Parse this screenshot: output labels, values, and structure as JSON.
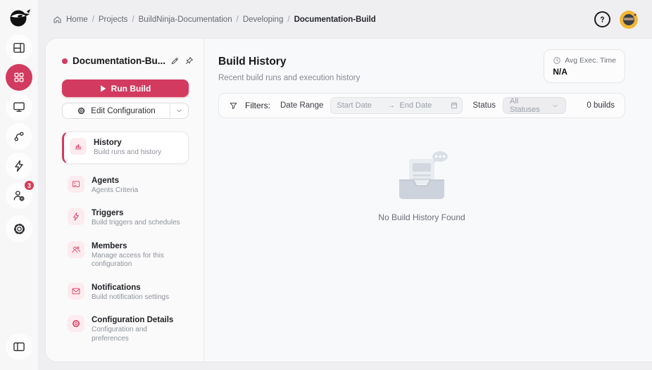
{
  "colors": {
    "accent": "#d23b5f",
    "accent_soft": "#fcebef",
    "badge": "#d53a52",
    "avatar_bg": "#f2b636"
  },
  "rail": {
    "icons": [
      "ninja-logo",
      "layout-icon",
      "apps-grid-icon",
      "monitor-icon",
      "git-branch-icon",
      "bolt-icon",
      "user-gear-icon",
      "gear-icon",
      "panel-toggle-icon"
    ],
    "active_icon": "apps-grid-icon",
    "badge_count": "3"
  },
  "header": {
    "breadcrumb": [
      "Home",
      "Projects",
      "BuildNinja-Documentation",
      "Developing",
      "Documentation-Build"
    ],
    "separator": "/"
  },
  "panel": {
    "title": "Documentation-Bu...",
    "run_build_label": "Run Build",
    "edit_config_label": "Edit Configuration",
    "menu": [
      {
        "label": "History",
        "desc": "Build runs and history",
        "icon": "chart-icon",
        "active": true
      },
      {
        "label": "Agents",
        "desc": "Agents Criteria",
        "icon": "agent-screen-icon",
        "active": false
      },
      {
        "label": "Triggers",
        "desc": "Build triggers and schedules",
        "icon": "bolt-icon",
        "active": false
      },
      {
        "label": "Members",
        "desc": "Manage access for this configuration",
        "icon": "people-icon",
        "active": false
      },
      {
        "label": "Notifications",
        "desc": "Build notification settings",
        "icon": "envelope-icon",
        "active": false
      },
      {
        "label": "Configuration Details",
        "desc": "Configuration and preferences",
        "icon": "gear-icon",
        "active": false
      }
    ]
  },
  "main": {
    "title": "Build History",
    "subtitle": "Recent build runs and execution history",
    "avg_exec": {
      "label": "Avg Exec. Time",
      "value": "N/A"
    },
    "filters": {
      "label": "Filters:",
      "date_range_label": "Date Range",
      "start_placeholder": "Start Date",
      "end_placeholder": "End Date",
      "range_arrow": "→",
      "status_label": "Status",
      "status_value": "All Statuses",
      "count": "0 builds"
    },
    "empty": {
      "message": "No Build History Found"
    }
  }
}
